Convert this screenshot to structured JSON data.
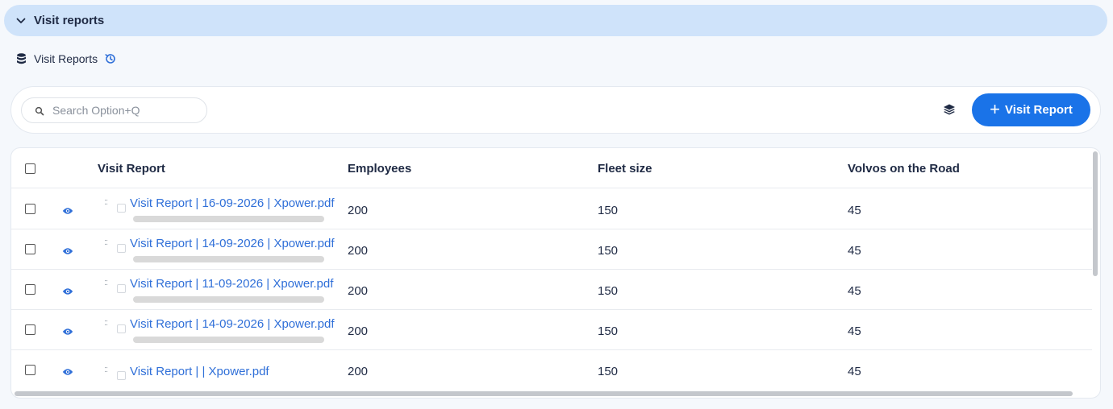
{
  "section": {
    "title": "Visit reports",
    "icon": "chevron-down-icon"
  },
  "subheader": {
    "title": "Visit Reports",
    "icons": [
      "database-icon",
      "history-icon"
    ]
  },
  "toolbar": {
    "search_placeholder": "Search Option+Q",
    "layers_icon": "layers-icon",
    "add_button_label": "Visit Report",
    "add_button_icon": "plus-icon"
  },
  "colors": {
    "accent": "#1a73e8",
    "header_bg": "#cfe3fa",
    "link": "#2f6fd8"
  },
  "table": {
    "columns": [
      "Visit Report",
      "Employees",
      "Fleet size",
      "Volvos on the Road"
    ],
    "rows": [
      {
        "report": "Visit Report | 16-09-2026 | Xpower.pdf",
        "employees": "200",
        "fleet_size": "150",
        "volvos_on_road": "45",
        "upload_progress": 1.0
      },
      {
        "report": "Visit Report | 14-09-2026 | Xpower.pdf",
        "employees": "200",
        "fleet_size": "150",
        "volvos_on_road": "45",
        "upload_progress": 1.0
      },
      {
        "report": "Visit Report | 11-09-2026 | Xpower.pdf",
        "employees": "200",
        "fleet_size": "150",
        "volvos_on_road": "45",
        "upload_progress": 1.0
      },
      {
        "report": "Visit Report | 14-09-2026 | Xpower.pdf",
        "employees": "200",
        "fleet_size": "150",
        "volvos_on_road": "45",
        "upload_progress": 1.0
      },
      {
        "report": "Visit Report | | Xpower.pdf",
        "employees": "200",
        "fleet_size": "150",
        "volvos_on_road": "45",
        "upload_progress": null
      }
    ]
  }
}
